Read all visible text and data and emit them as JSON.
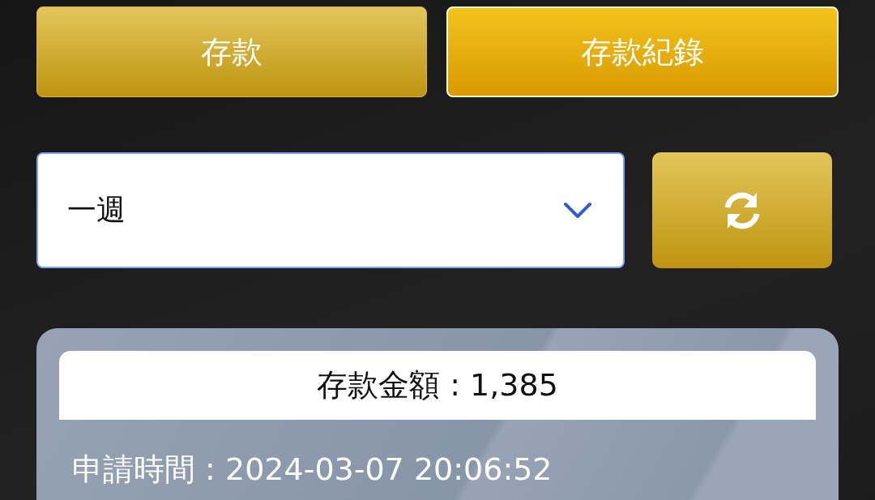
{
  "tabs": [
    {
      "label": "存款",
      "selected": false
    },
    {
      "label": "存款紀錄",
      "selected": true
    }
  ],
  "period_select": {
    "value": "一週"
  },
  "record": {
    "amount": "存款金額 : 1,385",
    "request_time": "申請時間 : 2024-03-07 20:06:52"
  }
}
